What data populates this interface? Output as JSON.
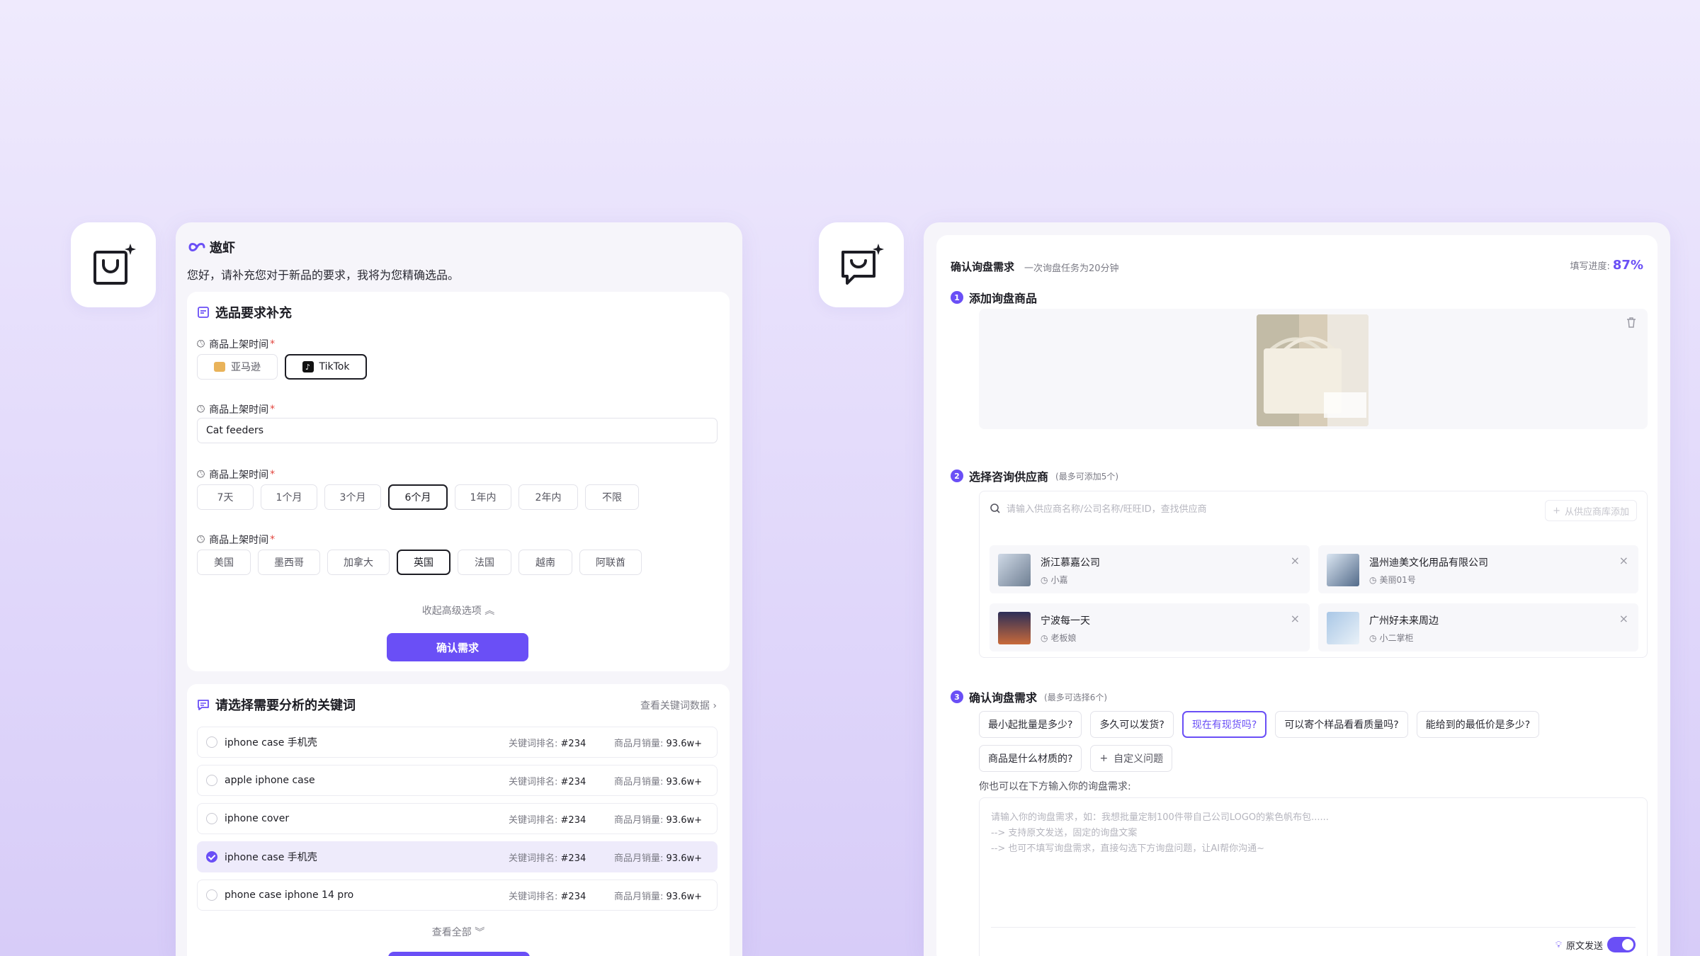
{
  "left": {
    "brand": "遨虾",
    "greeting": "您好，请补充您对于新品的要求，我将为您精确选品。",
    "requirements": {
      "title": "选品要求补充",
      "platform_label": "商品上架时间",
      "platforms": [
        "亚马逊",
        "TikTok"
      ],
      "keyword_label": "商品上架时间",
      "keyword_value": "Cat feeders",
      "time_label": "商品上架时间",
      "times": [
        "7天",
        "1个月",
        "3个月",
        "6个月",
        "1年内",
        "2年内",
        "不限"
      ],
      "region_label": "商品上架时间",
      "regions": [
        "美国",
        "墨西哥",
        "加拿大",
        "英国",
        "法国",
        "越南",
        "阿联酋"
      ],
      "collapse": "收起高级选项",
      "confirm": "确认需求"
    },
    "keywords": {
      "title": "请选择需要分析的关键词",
      "view_data": "查看关键词数据",
      "rank_label": "关键词排名:",
      "sales_label": "商品月销量:",
      "rows": [
        {
          "name": "iphone case 手机壳",
          "rank": "#234",
          "sales": "93.6w+"
        },
        {
          "name": "apple iphone case",
          "rank": "#234",
          "sales": "93.6w+"
        },
        {
          "name": "iphone cover",
          "rank": "#234",
          "sales": "93.6w+"
        },
        {
          "name": "iphone case 手机壳",
          "rank": "#234",
          "sales": "93.6w+"
        },
        {
          "name": "phone case iphone 14 pro",
          "rank": "#234",
          "sales": "93.6w+"
        }
      ],
      "view_all": "查看全部"
    }
  },
  "right": {
    "title": "确认询盘需求",
    "subtitle": "一次询盘任务为20分钟",
    "progress_label": "填写进度:",
    "progress_value": "87%",
    "step1": "添加询盘商品",
    "step2": "选择咨询供应商",
    "step2_note": "(最多可添加5个)",
    "search_placeholder": "请输入供应商名称/公司名称/旺旺ID，查找供应商",
    "add_from_library": "从供应商库添加",
    "suppliers": [
      {
        "name": "浙江慕嘉公司",
        "contact": "小嘉"
      },
      {
        "name": "温州迪美文化用品有限公司",
        "contact": "美丽01号"
      },
      {
        "name": "宁波每一天",
        "contact": "老板娘"
      },
      {
        "name": "广州好未来周边",
        "contact": "小二掌柜"
      }
    ],
    "step3": "确认询盘需求",
    "step3_note": "(最多可选择6个)",
    "questions_row1": [
      "最小起批量是多少?",
      "多久可以发货?",
      "现在有现货吗?",
      "可以寄个样品看看质量吗?",
      "能给到的最低价是多少?"
    ],
    "questions_row2": [
      "商品是什么材质的?"
    ],
    "custom_question": "自定义问题",
    "free_label": "你也可以在下方输入你的询盘需求:",
    "textarea_lines": [
      "请输入你的询盘需求，如：我想批量定制100件带自己公司LOGO的紫色帆布包......",
      "--> 支持原文发送，固定的询盘文案",
      "--> 也可不填写询盘需求，直接勾选下方询盘问题，让AI帮你沟通~"
    ],
    "toggle_label": "原文发送"
  },
  "colors": {
    "accent": "#6a4ff6",
    "required": "#e2463f"
  }
}
